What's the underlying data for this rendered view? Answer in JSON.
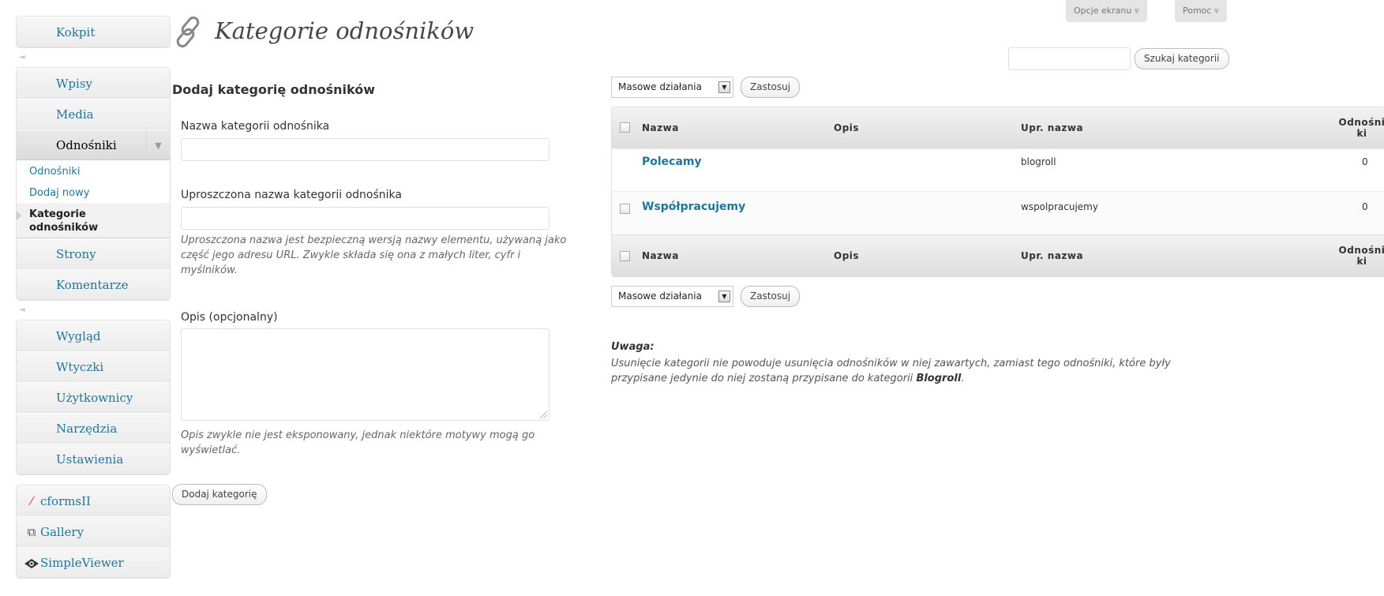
{
  "header": {
    "title": "Kategorie odnośników",
    "screen_options": "Opcje ekranu",
    "help": "Pomoc"
  },
  "sidebar": {
    "dashboard": "Kokpit",
    "group1": [
      "Wpisy",
      "Media"
    ],
    "links_menu": "Odnośniki",
    "links_submenu": [
      "Odnośniki",
      "Dodaj nowy"
    ],
    "links_current_line1": "Kategorie",
    "links_current_line2": "odnośników",
    "group1_after": [
      "Strony",
      "Komentarze"
    ],
    "group2": [
      "Wygląd",
      "Wtyczki",
      "Użytkownicy",
      "Narzędzia",
      "Ustawienia"
    ],
    "plugins": [
      {
        "label": "cformsII",
        "icon": "slash-icon"
      },
      {
        "label": "Gallery",
        "icon": "gallery-icon"
      },
      {
        "label": "SimpleViewer",
        "icon": "eye-icon"
      }
    ]
  },
  "search": {
    "button": "Szukaj kategorii",
    "value": ""
  },
  "form": {
    "heading": "Dodaj kategorię odnośników",
    "name_label": "Nazwa kategorii odnośnika",
    "name_value": "",
    "slug_label": "Uproszczona nazwa kategorii odnośnika",
    "slug_value": "",
    "slug_help": "Uproszczona nazwa jest bezpieczną wersją nazwy elementu, używaną jako część jego adresu URL. Zwykle składa się ona z małych liter, cyfr i myślników.",
    "desc_label": "Opis (opcjonalny)",
    "desc_value": "",
    "desc_help": "Opis zwykle nie jest eksponowany, jednak niektóre motywy mogą go wyświetlać.",
    "submit": "Dodaj kategorię"
  },
  "bulk": {
    "select_value": "Masowe działania",
    "apply": "Zastosuj"
  },
  "table": {
    "columns": {
      "name": "Nazwa",
      "desc": "Opis",
      "slug": "Upr. nazwa",
      "count_line1": "Odnośni",
      "count_line2": "ki"
    },
    "rows": [
      {
        "name": "Polecamy",
        "description": "",
        "slug": "blogroll",
        "count": "0",
        "checkbox": false
      },
      {
        "name": "Współpracujemy",
        "description": "",
        "slug": "wspolpracujemy",
        "count": "0",
        "checkbox": true
      }
    ]
  },
  "note": {
    "title": "Uwaga:",
    "text_before": "Usunięcie kategorii nie powoduje usunięcia odnośników w niej zawartych, zamiast tego odnośniki, które były przypisane jedynie do niej zostaną przypisane do kategorii ",
    "text_bold": "Blogroll",
    "text_after": "."
  },
  "colors": {
    "link": "#21759b",
    "title": "#464646"
  }
}
